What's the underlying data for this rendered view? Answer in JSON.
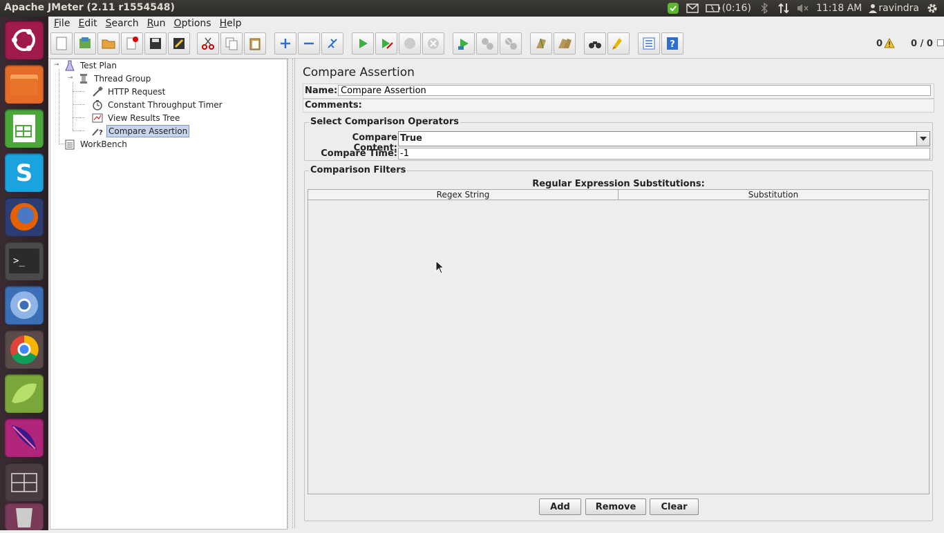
{
  "window": {
    "title": "Apache JMeter (2.11 r1554548)"
  },
  "tray": {
    "battery": "(0:16)",
    "clock": "11:18 AM",
    "user": "ravindra"
  },
  "menu": [
    {
      "label": "File"
    },
    {
      "label": "Edit"
    },
    {
      "label": "Search"
    },
    {
      "label": "Run"
    },
    {
      "label": "Options"
    },
    {
      "label": "Help"
    }
  ],
  "toolbar": {
    "warnings": "0",
    "threads": "0 / 0"
  },
  "tree": {
    "items": [
      {
        "label": "Test Plan"
      },
      {
        "label": "Thread Group"
      },
      {
        "label": "HTTP Request"
      },
      {
        "label": "Constant Throughput Timer"
      },
      {
        "label": "View Results Tree"
      },
      {
        "label": "Compare Assertion"
      },
      {
        "label": "WorkBench"
      }
    ]
  },
  "editor": {
    "title": "Compare Assertion",
    "name_label": "Name:",
    "name_value": "Compare Assertion",
    "comments_label": "Comments:",
    "operators_group": "Select Comparison Operators",
    "compare_content_label": "Compare Content:",
    "compare_content_value": "True",
    "compare_time_label": "Compare Time:",
    "compare_time_value": "-1",
    "filters_group": "Comparison Filters",
    "table_caption": "Regular Expression Substitutions:",
    "columns": [
      "Regex String",
      "Substitution"
    ],
    "buttons": {
      "add": "Add",
      "remove": "Remove",
      "clear": "Clear"
    }
  },
  "colors": {
    "accent": "#7b98c8",
    "panel": "#3c3b37"
  }
}
